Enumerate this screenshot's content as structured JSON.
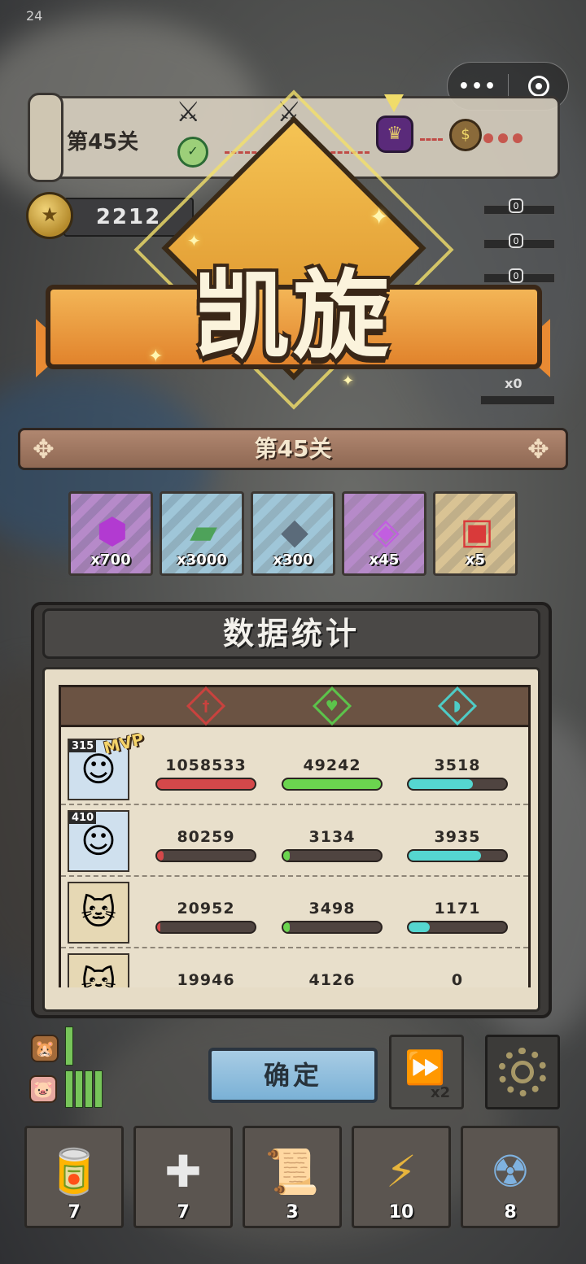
{
  "status": {
    "time": "24"
  },
  "capsule": {
    "menu_icon": "more-dots-icon",
    "close_icon": "target-icon"
  },
  "level_bar": {
    "label": "第45关"
  },
  "coins": {
    "amount": "2212"
  },
  "side_counters": [
    "0",
    "0",
    "0",
    "0"
  ],
  "side_multiplier": "x0",
  "victory": {
    "title": "凯旋"
  },
  "level_banner": {
    "label": "第45关"
  },
  "rewards": [
    {
      "name": "purple-gem",
      "qty": "x700",
      "bg": "#b68ac9"
    },
    {
      "name": "green-banknote",
      "qty": "x3000",
      "bg": "#9fc6d8"
    },
    {
      "name": "steel-ore",
      "qty": "x300",
      "bg": "#9fc6d8"
    },
    {
      "name": "purple-crystal",
      "qty": "x45",
      "bg": "#b68ac9"
    },
    {
      "name": "red-cube",
      "qty": "x5",
      "bg": "#d9c394"
    }
  ],
  "stats": {
    "title": "数据统计",
    "columns": [
      {
        "icon": "sword-icon",
        "color": "#c9423e"
      },
      {
        "icon": "heart-heal-icon",
        "color": "#5cc34b"
      },
      {
        "icon": "shield-icon",
        "color": "#4ecbc6"
      }
    ],
    "rows": [
      {
        "level": "315",
        "mvp": "MVP",
        "avatar": "spiky-hair-boy",
        "damage": "1058533",
        "heal": "49242",
        "shield": "3518",
        "damage_pct": 1.0,
        "heal_pct": 1.0,
        "shield_pct": 0.66
      },
      {
        "level": "410",
        "mvp": "",
        "avatar": "spiky-hair-boy",
        "damage": "80259",
        "heal": "3134",
        "shield": "3935",
        "damage_pct": 0.07,
        "heal_pct": 0.07,
        "shield_pct": 0.74
      },
      {
        "level": "",
        "mvp": "",
        "avatar": "cowboy-cat",
        "damage": "20952",
        "heal": "3498",
        "shield": "1171",
        "damage_pct": 0.03,
        "heal_pct": 0.07,
        "shield_pct": 0.22
      },
      {
        "level": "",
        "mvp": "",
        "avatar": "cowboy-cat",
        "damage": "19946",
        "heal": "4126",
        "shield": "0",
        "damage_pct": 0.02,
        "heal_pct": 0.08,
        "shield_pct": 0.0
      }
    ]
  },
  "buttons": {
    "confirm": "确定",
    "speed": "x2"
  },
  "items": [
    {
      "icon": "cola-can-icon",
      "count": "7"
    },
    {
      "icon": "medkit-icon",
      "count": "7"
    },
    {
      "icon": "scroll-icon",
      "count": "3"
    },
    {
      "icon": "lightning-card-icon",
      "count": "10"
    },
    {
      "icon": "nuclear-bomb-icon",
      "count": "8"
    }
  ]
}
